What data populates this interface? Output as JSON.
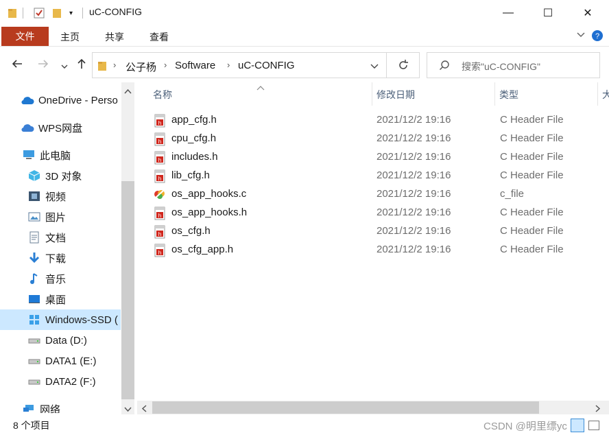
{
  "window": {
    "title": "uC-CONFIG",
    "minimize_glyph": "—",
    "maximize_glyph": "☐",
    "close_glyph": "✕"
  },
  "ribbon": {
    "tabs": [
      "文件",
      "主页",
      "共享",
      "查看"
    ],
    "accent_color": "#b83b1e"
  },
  "address": {
    "crumbs": [
      "公子杨",
      "Software",
      "uC-CONFIG"
    ],
    "search_placeholder": "搜索\"uC-CONFIG\""
  },
  "sidebar": {
    "items": [
      {
        "label": "OneDrive - Perso",
        "icon": "cloud-icon"
      },
      {
        "label": "WPS网盘",
        "icon": "cloud-icon"
      },
      {
        "label": "此电脑",
        "icon": "computer-icon"
      },
      {
        "label": "3D 对象",
        "icon": "cube-icon"
      },
      {
        "label": "视频",
        "icon": "film-icon"
      },
      {
        "label": "图片",
        "icon": "picture-icon"
      },
      {
        "label": "文档",
        "icon": "document-icon"
      },
      {
        "label": "下载",
        "icon": "download-icon"
      },
      {
        "label": "音乐",
        "icon": "music-icon"
      },
      {
        "label": "桌面",
        "icon": "desktop-icon"
      },
      {
        "label": "Windows-SSD (",
        "icon": "windows-drive-icon",
        "selected": true
      },
      {
        "label": "Data (D:)",
        "icon": "drive-icon"
      },
      {
        "label": "DATA1 (E:)",
        "icon": "drive-icon"
      },
      {
        "label": "DATA2 (F:)",
        "icon": "drive-icon"
      },
      {
        "label": "网络",
        "icon": "network-icon"
      }
    ]
  },
  "columns": {
    "name": "名称",
    "date": "修改日期",
    "type": "类型",
    "size_partial": "大"
  },
  "files": [
    {
      "name": "app_cfg.h",
      "date": "2021/12/2 19:16",
      "type": "C Header File",
      "icon": "header-file-icon"
    },
    {
      "name": "cpu_cfg.h",
      "date": "2021/12/2 19:16",
      "type": "C Header File",
      "icon": "header-file-icon"
    },
    {
      "name": "includes.h",
      "date": "2021/12/2 19:16",
      "type": "C Header File",
      "icon": "header-file-icon"
    },
    {
      "name": "lib_cfg.h",
      "date": "2021/12/2 19:16",
      "type": "C Header File",
      "icon": "header-file-icon"
    },
    {
      "name": "os_app_hooks.c",
      "date": "2021/12/2 19:16",
      "type": "c_file",
      "icon": "c-file-icon"
    },
    {
      "name": "os_app_hooks.h",
      "date": "2021/12/2 19:16",
      "type": "C Header File",
      "icon": "header-file-icon"
    },
    {
      "name": "os_cfg.h",
      "date": "2021/12/2 19:16",
      "type": "C Header File",
      "icon": "header-file-icon"
    },
    {
      "name": "os_cfg_app.h",
      "date": "2021/12/2 19:16",
      "type": "C Header File",
      "icon": "header-file-icon"
    }
  ],
  "status": {
    "item_count": "8 个项目"
  },
  "watermark": "CSDN @明里缥yc"
}
